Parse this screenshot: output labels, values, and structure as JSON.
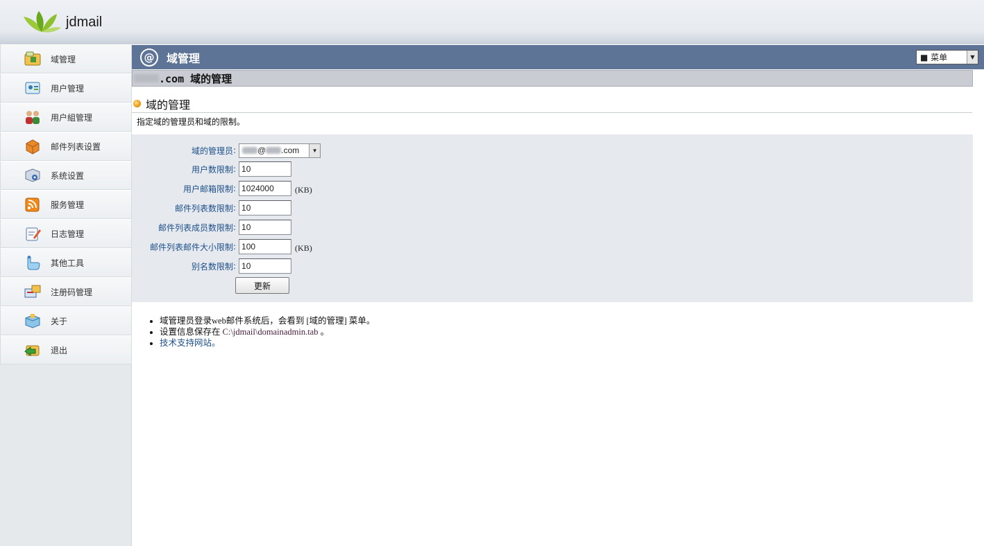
{
  "app": {
    "brand": "jdmail",
    "logo_icon": "leaf-logo-icon"
  },
  "sidebar": {
    "items": [
      {
        "label": "域管理",
        "icon": "domain-folder-icon"
      },
      {
        "label": "用户管理",
        "icon": "user-card-icon"
      },
      {
        "label": "用户組管理",
        "icon": "user-group-icon"
      },
      {
        "label": "邮件列表设置",
        "icon": "mail-list-box-icon"
      },
      {
        "label": "系统设置",
        "icon": "system-settings-icon"
      },
      {
        "label": "服务管理",
        "icon": "rss-service-icon"
      },
      {
        "label": "日志管理",
        "icon": "log-notepad-icon"
      },
      {
        "label": "其他工具",
        "icon": "tools-hand-icon"
      },
      {
        "label": "注册码管理",
        "icon": "license-key-icon"
      },
      {
        "label": "关于",
        "icon": "about-box-icon"
      },
      {
        "label": "退出",
        "icon": "logout-arrow-icon"
      }
    ]
  },
  "titlebar": {
    "title": "域管理",
    "icon": "at-sign-icon",
    "menu_select": "■ 菜单"
  },
  "domainbar": {
    "suffix": ".com 域的管理"
  },
  "section": {
    "title": "域的管理",
    "description": "指定域的管理员和域的限制。"
  },
  "form": {
    "admin": {
      "label": "域的管理员",
      "at": "@",
      "suffix": ".com"
    },
    "user_limit": {
      "label": "用户数限制",
      "value": "10"
    },
    "mailbox_limit": {
      "label": "用户邮箱限制",
      "value": "1024000",
      "unit": "(KB)"
    },
    "list_limit": {
      "label": "邮件列表数限制",
      "value": "10"
    },
    "list_member_limit": {
      "label": "邮件列表成员数限制",
      "value": "10"
    },
    "list_mail_size_limit": {
      "label": "邮件列表邮件大小限制",
      "value": "100",
      "unit": "(KB)"
    },
    "alias_limit": {
      "label": "别名数限制",
      "value": "10"
    },
    "submit_label": "更新",
    "colon": ":"
  },
  "notes": {
    "line1_a": "域管理员登录web邮件系统后，会看到",
    "line1_b": "[域的管理]",
    "line1_c": "菜单。",
    "line2_a": "设置信息保存在",
    "line2_b": "C:\\jdmail\\domainadmin.tab",
    "line2_c": "。",
    "line3": "技术支持网站。"
  },
  "colors": {
    "titlebar": "#5d7497",
    "form_bg": "#e6eaee",
    "label": "#1e4f8a"
  }
}
